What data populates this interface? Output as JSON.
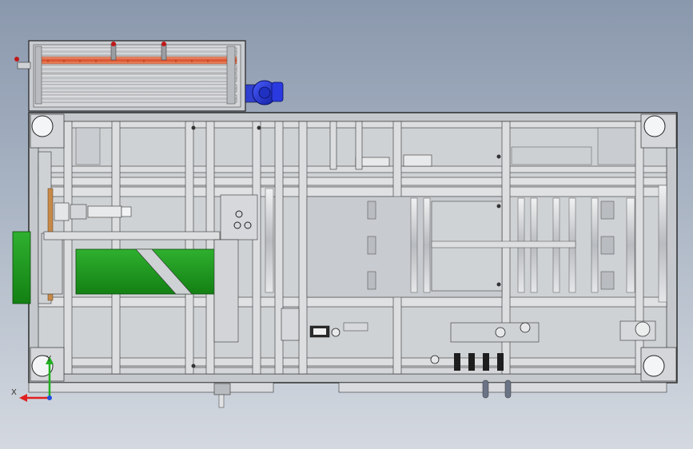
{
  "viewport": {
    "axis_x_label": "X",
    "axis_y_label": "Y",
    "axis_x_color": "#e02020",
    "axis_y_color": "#20b020"
  },
  "colors": {
    "frame_fill": "#c4c7cb",
    "frame_stroke": "#2a2a2a",
    "rail_fill": "#d8dadd",
    "belt_green": "#1f9a1f",
    "motor_blue": "#1a2fd6",
    "heater_red": "#e0603a",
    "background_top": "#8a98ad",
    "background_bottom": "#d4d9e0"
  },
  "components": {
    "heater_roller_box": "heater-roller-box",
    "blue_gear_motor": "blue-gear-motor",
    "green_conveyor_belt": "green-conveyor-belt",
    "main_frame": "main-frame",
    "corner_casters": [
      "caster-top-left",
      "caster-top-right",
      "caster-bottom-left",
      "caster-bottom-right"
    ]
  }
}
